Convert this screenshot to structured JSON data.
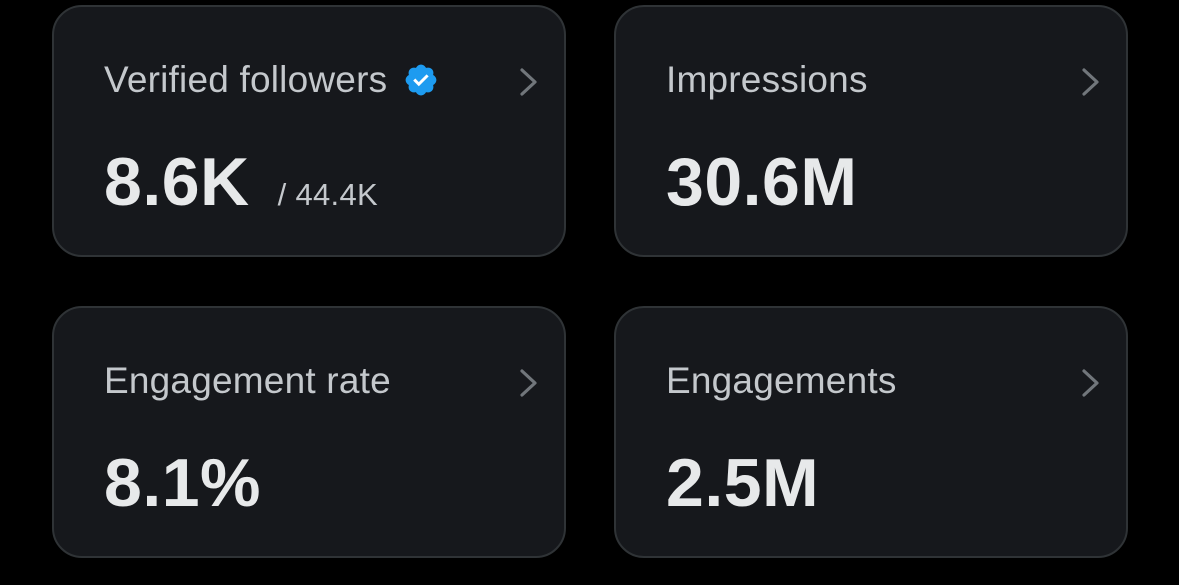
{
  "colors": {
    "background": "#000000",
    "card_background": "#16181c",
    "card_border": "#2f3336",
    "title_text": "#c4c8cc",
    "value_text": "#e7e9ea",
    "verified_badge": "#1d9bf0"
  },
  "cards": [
    {
      "title": "Verified followers",
      "icon": "verified-badge-icon",
      "value": "8.6K",
      "subvalue": "/ 44.4K"
    },
    {
      "title": "Impressions",
      "value": "30.6M"
    },
    {
      "title": "Engagement rate",
      "value": "8.1%"
    },
    {
      "title": "Engagements",
      "value": "2.5M"
    }
  ]
}
